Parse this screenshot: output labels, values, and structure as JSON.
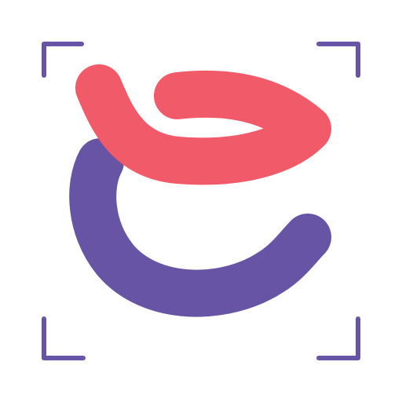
{
  "logo": {
    "icon_name": "scan-e-logo-icon",
    "colors": {
      "background": "#ffffff",
      "frame": "#6854A4",
      "purple_stroke": "#6854A4",
      "coral_stroke": "#F15A69"
    }
  }
}
